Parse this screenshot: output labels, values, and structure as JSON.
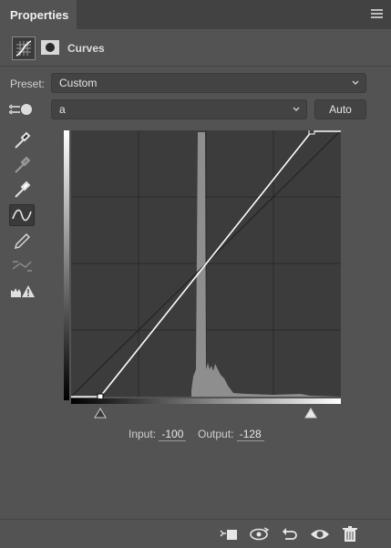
{
  "panel": {
    "tab_title": "Properties"
  },
  "header": {
    "title": "Curves"
  },
  "preset": {
    "label": "Preset:",
    "value": "Custom"
  },
  "channel": {
    "value": "a",
    "auto_label": "Auto"
  },
  "curve": {
    "input_label": "Input:",
    "input_value": "-100",
    "output_label": "Output:",
    "output_value": "-128"
  },
  "colors": {
    "background": "#535353",
    "graph_bg": "#3c3c3c",
    "curve": "#ffffff"
  }
}
